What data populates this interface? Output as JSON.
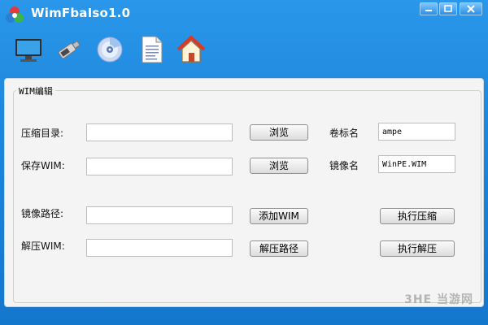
{
  "window": {
    "title": "WimFbaIso1.0"
  },
  "toolbar": {
    "items": [
      {
        "icon": "monitor-icon"
      },
      {
        "icon": "usb-drive-icon"
      },
      {
        "icon": "cd-disc-icon"
      },
      {
        "icon": "document-icon"
      },
      {
        "icon": "home-icon"
      }
    ]
  },
  "group": {
    "legend": "WIM编辑"
  },
  "form": {
    "compress_dir_label": "压缩目录:",
    "compress_dir_value": "",
    "browse_label_1": "浏览",
    "save_wim_label": "保存WIM:",
    "save_wim_value": "",
    "browse_label_2": "浏览",
    "volume_name_label": "卷标名",
    "volume_name_value": "ampe",
    "image_name_label": "镜像名",
    "image_name_value": "WinPE.WIM",
    "image_path_label": "镜像路径:",
    "image_path_value": "",
    "add_wim_label": "添加WIM",
    "run_compress_label": "执行压缩",
    "extract_wim_label": "解压WIM:",
    "extract_wim_value": "",
    "extract_path_label": "解压路径",
    "run_extract_label": "执行解压"
  },
  "watermark": "3HE 当游网"
}
